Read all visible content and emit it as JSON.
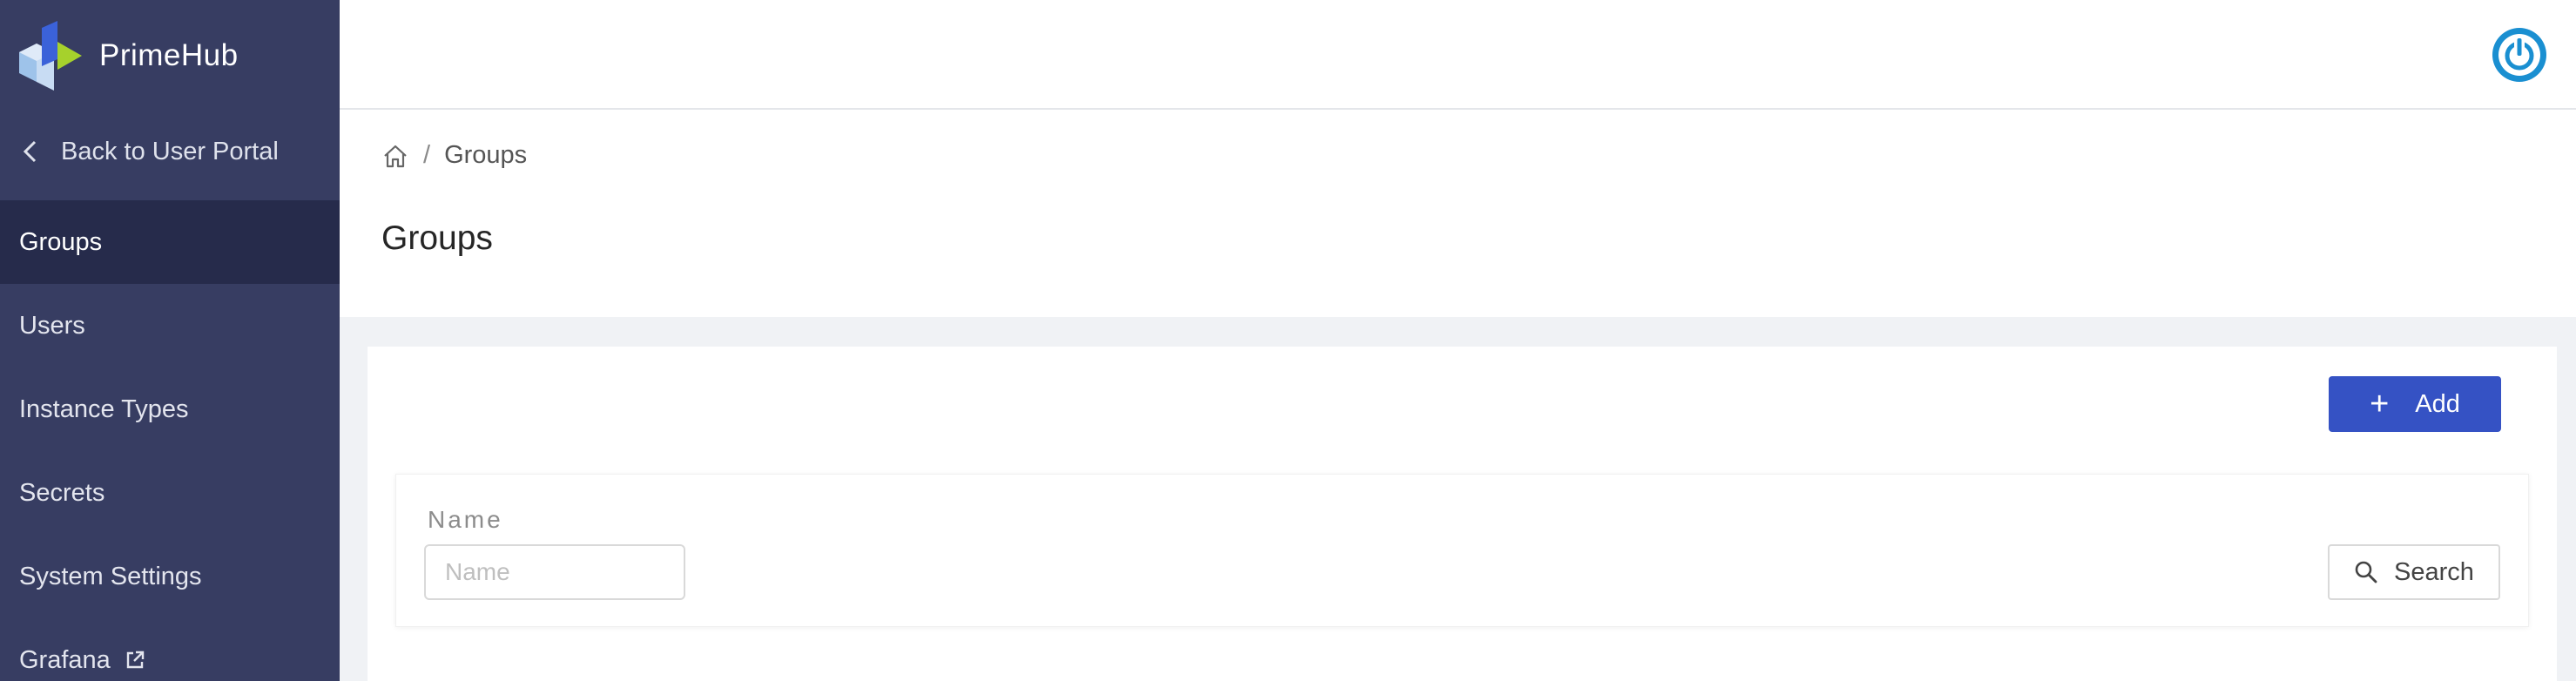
{
  "brand": {
    "name": "PrimeHub"
  },
  "sidebar": {
    "back_label": "Back to User Portal",
    "items": [
      {
        "label": "Groups",
        "active": true
      },
      {
        "label": "Users"
      },
      {
        "label": "Instance Types"
      },
      {
        "label": "Secrets"
      },
      {
        "label": "System Settings"
      },
      {
        "label": "Grafana",
        "external": true
      }
    ]
  },
  "header": {
    "icon": "power-icon"
  },
  "breadcrumb": {
    "icon": "home-icon",
    "current": "Groups"
  },
  "page": {
    "title": "Groups"
  },
  "toolbar": {
    "add_label": "Add"
  },
  "filter": {
    "name_label": "Name",
    "name_placeholder": "Name",
    "name_value": "",
    "search_label": "Search"
  },
  "colors": {
    "sidebar_bg": "#373d62",
    "sidebar_active_bg": "#262b4b",
    "primary": "#3552c4",
    "power_icon": "#1a8fd1"
  }
}
